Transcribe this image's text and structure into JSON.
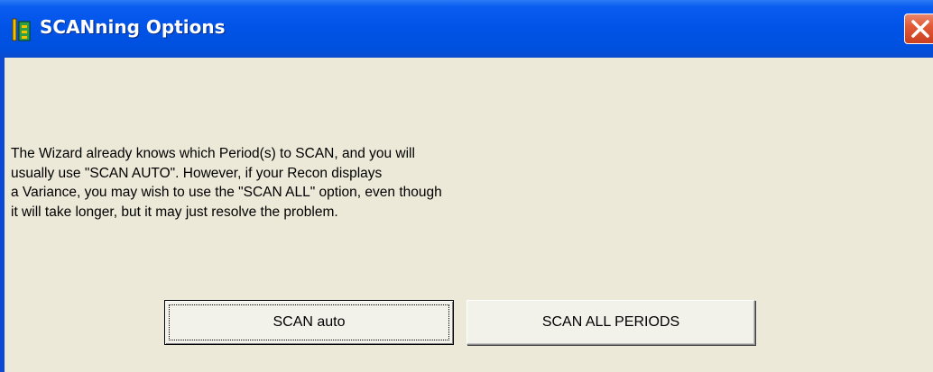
{
  "window": {
    "title": "SCANning Options",
    "title_icon": "wizard-app-icon",
    "close_icon": "close-icon",
    "titlebar_color": "#0053e6",
    "close_color": "#e25a36"
  },
  "content": {
    "description": "The Wizard already knows which Period(s) to SCAN, and you will\nusually use \"SCAN AUTO\". However, if your Recon displays\na Variance, you may wish to use the \"SCAN ALL\" option, even though\nit will take longer, but it may just resolve the problem."
  },
  "buttons": {
    "scan_auto": "SCAN auto",
    "scan_all": "SCAN ALL PERIODS"
  }
}
